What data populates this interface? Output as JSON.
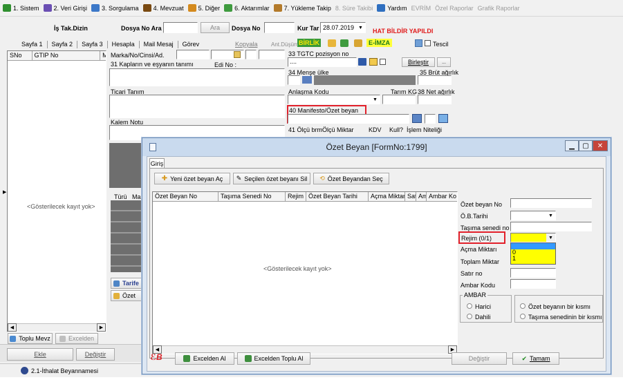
{
  "menubar": {
    "items": [
      {
        "label": "1. Sistem",
        "icon": "system-icon",
        "color": "#2f8f2f"
      },
      {
        "label": "2. Veri Girişi",
        "icon": "data-entry-icon",
        "color": "#6b4fb3"
      },
      {
        "label": "3. Sorgulama",
        "icon": "query-icon",
        "color": "#3c78c8"
      },
      {
        "label": "4. Mevzuat",
        "icon": "law-icon",
        "color": "#7a4a12"
      },
      {
        "label": "5. Diğer",
        "icon": "other-icon",
        "color": "#d48a1e"
      },
      {
        "label": "6. Aktarımlar",
        "icon": "transfer-icon",
        "color": "#3f9b3f"
      },
      {
        "label": "7. Yükleme Takip",
        "icon": "loading-icon",
        "color": "#b37a2a"
      },
      {
        "label": "8. Süre Takibi",
        "disabled": true
      },
      {
        "label": "Yardım",
        "icon": "help-icon",
        "color": "#2f6fc0"
      },
      {
        "label": "EVRİM",
        "disabled": true
      },
      {
        "label": "Özel Raporlar",
        "disabled": true
      },
      {
        "label": "Grafik Raporlar",
        "disabled": true
      }
    ]
  },
  "header": {
    "is_takip": "İş Tak.Dizin",
    "dosya_no_ara": "Dosya No Ara",
    "ara_button": "Ara",
    "dosya_no": "Dosya No",
    "kur_tar_label": "Kur Tar",
    "kur_tar_value": "28.07.2019",
    "warning": "HAT BİLDİR YAPILDI"
  },
  "toolbar": {
    "tabs": [
      "Sayfa 1",
      "Sayfa 2",
      "Sayfa 3",
      "Hesapla",
      "Mail Mesaj",
      "Görev"
    ],
    "kopyala": "Kopyala",
    "ant_dusum": "Ant.Düşüm",
    "birlik": "BİRLİK",
    "e_imza": "E-İMZA",
    "tescil": "Tescil"
  },
  "left_grid": {
    "columns": [
      "SNo",
      "GTIP No",
      "Mi"
    ],
    "empty_text": "<Gösterilecek kayıt yok>",
    "toplu_mevz": "Toplu Mevz",
    "excelden": "Excelden"
  },
  "form": {
    "marka": "Marka/No/Cinsi/Ad.",
    "kaplar": "31 Kapların ve eşyanın tanımı",
    "edi_no": "Edi No :",
    "ticari_tanim": "Ticari Tanım",
    "kalem_notu": "Kalem Notu",
    "tgtc": "33 TGTC pozisyon no",
    "tgtc_value": "....",
    "birlestir": "Birleştir",
    "mense": "34 Menşe ülke",
    "brut": "35 Brüt ağırlık",
    "anlasma": "Anlaşma Kodu",
    "tarim": "Tarım KG",
    "net": "38 Net ağırlık",
    "manifesto": "40 Manifesto/Özet beyan",
    "olcu_brm": "41 Ölçü brm",
    "olcu_miktar": "Ölçü Miktar",
    "kdv": "KDV",
    "kull": "Kull?",
    "islem": "İşlem Niteliği",
    "turu": "Türü",
    "ma": "Ma",
    "tarife": "Tarife",
    "ozet": "Özet"
  },
  "bottom": {
    "ekle": "Ekle",
    "degistir": "Değiştir",
    "status": "2.1-İthalat Beyannamesi"
  },
  "dialog": {
    "title": "Özet Beyan [FormNo:1799]",
    "tab": "Giriş",
    "btn_new": "Yeni özet beyan Aç",
    "btn_delete": "Seçilen özet beyanı Sil",
    "btn_select": "Özet Beyandan Seç",
    "columns": [
      "Özet Beyan No",
      "Taşıma Senedi No",
      "Rejim",
      "Özet Beyan Tarihi",
      "Açma Miktarı",
      "Sat",
      "Am",
      "Ambar Ko"
    ],
    "empty_text": "<Gösterilecek kayıt yok>",
    "fields": {
      "ozet_beyan_no": "Özet beyan No",
      "ob_tarihi": "Ö.B.Tarihi",
      "tasima_senedi": "Taşıma senedi no",
      "rejim": "Rejim (0/1)",
      "acma_miktari": "Açma Miktarı",
      "toplam_miktar": "Toplam Miktar",
      "satir_no": "Satır no",
      "ambar_kodu": "Ambar Kodu"
    },
    "rejim_options": [
      "0",
      "1"
    ],
    "ambar": {
      "legend": "AMBAR",
      "harici": "Harici",
      "dahili": "Dahili",
      "ozet_kismi": "Özet beyanın bir kısmı",
      "tasima_kismi": "Taşıma senedinin bir kısmı"
    },
    "excelden_al": "Excelden Al",
    "excelden_toplu_al": "Excelden Toplu Al",
    "degistir": "Değiştir",
    "tamam": "Tamam"
  }
}
